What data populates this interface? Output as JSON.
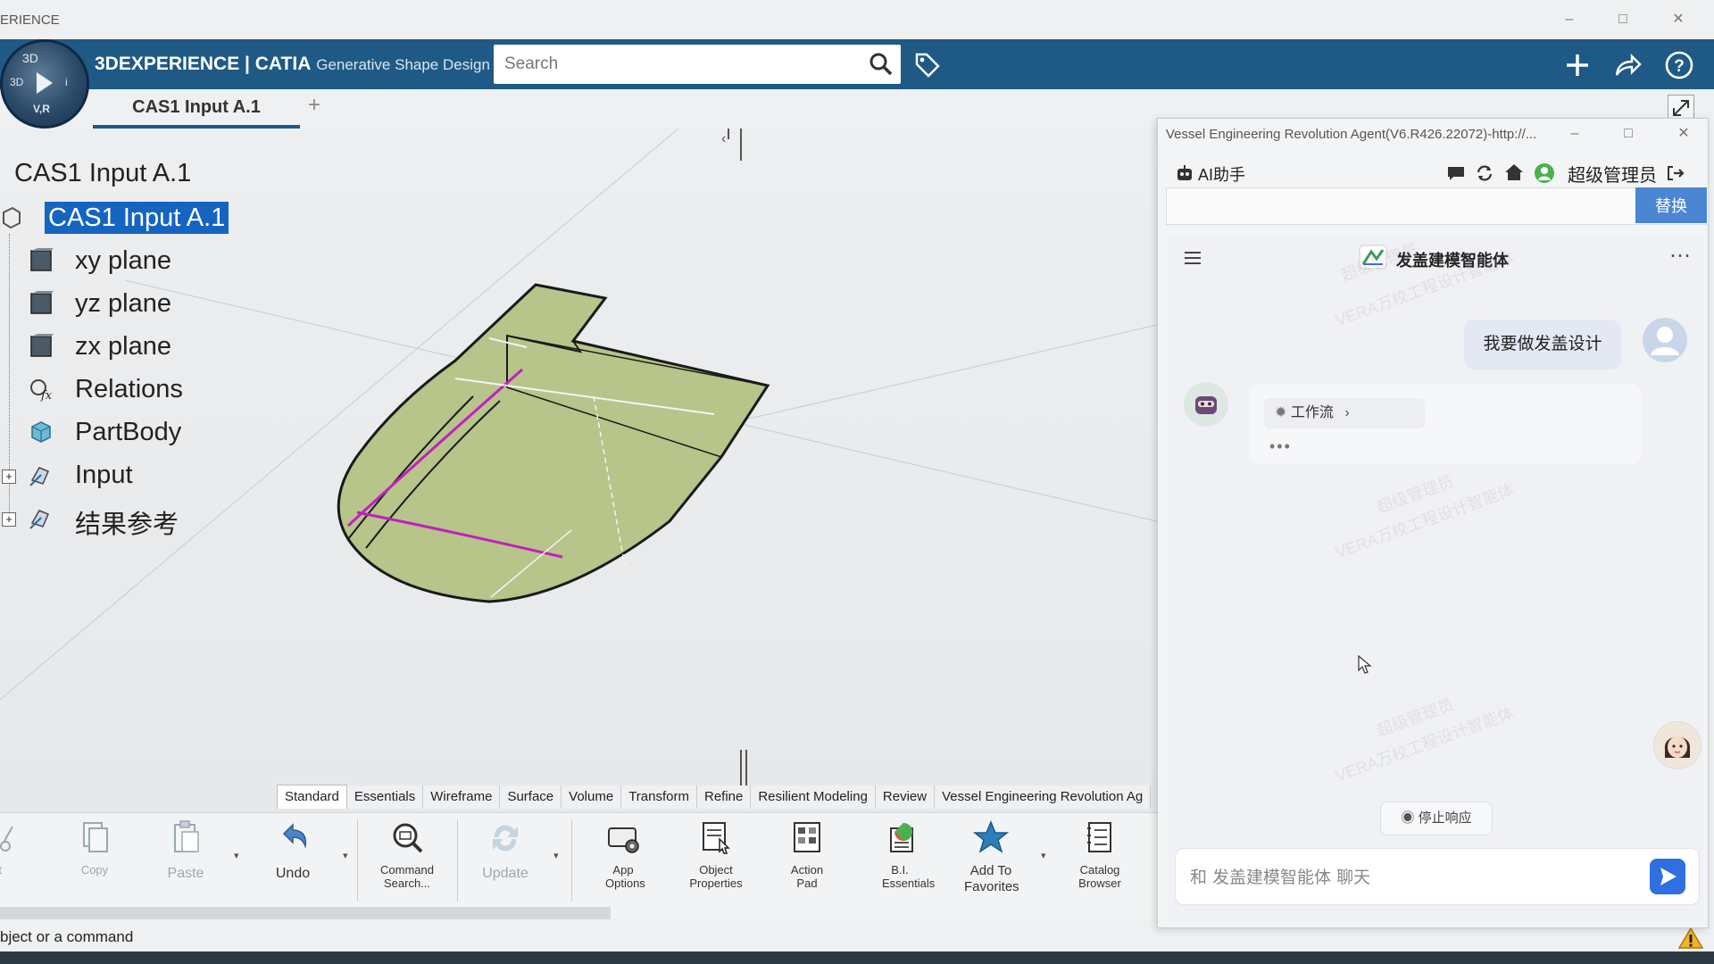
{
  "window": {
    "title_fragment": "ERIENCE"
  },
  "header": {
    "compass": {
      "top": "3D",
      "left": "3D",
      "right": "i",
      "bottom": "V,R"
    },
    "brand": "3DEXPERIENCE | CATIA",
    "app": "Generative Shape Design",
    "search_placeholder": "Search",
    "accent": "#1f5a86"
  },
  "tabs": {
    "active": "CAS1 Input A.1",
    "add": "+"
  },
  "tree": {
    "root": "CAS1 Input A.1",
    "selected": "CAS1 Input A.1",
    "items": [
      {
        "label": "xy plane",
        "icon": "plane-icon"
      },
      {
        "label": "yz plane",
        "icon": "plane-icon"
      },
      {
        "label": "zx plane",
        "icon": "plane-icon"
      },
      {
        "label": "Relations",
        "icon": "relations-icon"
      },
      {
        "label": "PartBody",
        "icon": "partbody-icon"
      },
      {
        "label": "Input",
        "icon": "geometric-set-icon"
      },
      {
        "label": "结果参考",
        "icon": "geometric-set-icon"
      }
    ],
    "selection_color": "#1565c0"
  },
  "workbench_tabs": [
    "Standard",
    "Essentials",
    "Wireframe",
    "Surface",
    "Volume",
    "Transform",
    "Refine",
    "Resilient Modeling",
    "Review",
    "Vessel Engineering Revolution Ag"
  ],
  "toolbar": {
    "cut": "ut",
    "copy": "Copy",
    "paste": "Paste",
    "undo": "Undo",
    "command_search": "Command Search...",
    "update": "Update",
    "app_options": "App Options",
    "object_properties": "Object Properties",
    "action_pad": "Action Pad",
    "bi_essentials": "B.I. Essentials",
    "add_favorites": "Add To Favorites",
    "catalog_browser": "Catalog Browser"
  },
  "status": {
    "text": "bject or a command"
  },
  "agent": {
    "title": "Vessel Engineering Revolution Agent(V6.R426.22072)-http://...",
    "ai_label": "AI助手",
    "user": "超级管理员",
    "replace": "替换",
    "agent_name": "发盖建模智能体",
    "user_message": "我要做发盖设计",
    "workflow": "工作流",
    "typing": "•••",
    "stop": "停止响应",
    "input_placeholder": "和 发盖建模智能体 聊天",
    "watermark_1": "超级管理员",
    "watermark_2": "VERA万校工程设计智能体",
    "send_color": "#2f6fe0"
  }
}
